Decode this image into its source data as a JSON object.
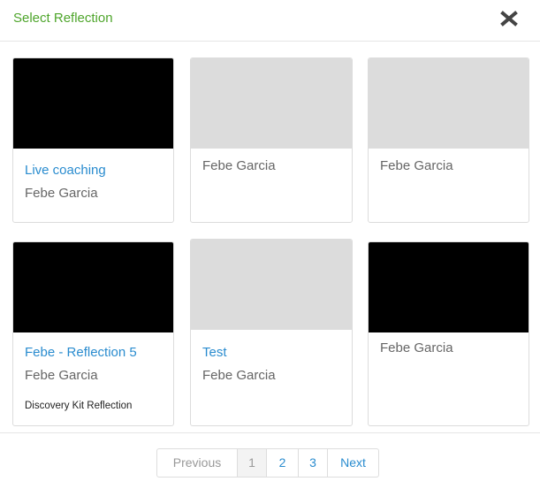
{
  "modal": {
    "title": "Select Reflection",
    "close_icon": "close-icon"
  },
  "cards": [
    {
      "title": "Live coaching",
      "author": "Febe Garcia",
      "extra": "",
      "thumb": "dark"
    },
    {
      "title": "",
      "author": "Febe Garcia",
      "extra": "",
      "thumb": "light"
    },
    {
      "title": "",
      "author": "Febe Garcia",
      "extra": "",
      "thumb": "light"
    },
    {
      "title": "Febe - Reflection 5",
      "author": "Febe Garcia",
      "extra": "Discovery Kit Reflection",
      "thumb": "dark"
    },
    {
      "title": "Test",
      "author": "Febe Garcia",
      "extra": "",
      "thumb": "light"
    },
    {
      "title": "",
      "author": "Febe Garcia",
      "extra": "",
      "thumb": "dark"
    }
  ],
  "pagination": {
    "previous": "Previous",
    "pages": [
      "1",
      "2",
      "3"
    ],
    "current_page": "1",
    "next": "Next"
  },
  "colors": {
    "title_green": "#4ea52b",
    "link_blue": "#2a8ccf",
    "thumb_dark": "#000000",
    "thumb_light": "#dcdcdc"
  }
}
